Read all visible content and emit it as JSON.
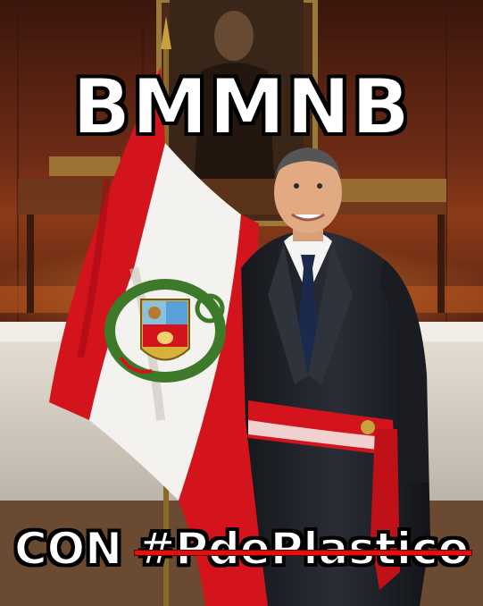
{
  "meme": {
    "top_text": "BMMNB",
    "bottom_prefix": "CON",
    "bottom_struck": "#PdePlastico",
    "strike_color": "#e01010"
  },
  "photo": {
    "subjects": [
      "man-in-suit",
      "peru-flag",
      "presidential-sash",
      "wall-portrait"
    ],
    "colors": {
      "wall": "#5a2314",
      "flag_red": "#d3141c",
      "flag_white": "#f4f2ee",
      "suit": "#1d1f25",
      "tie": "#1b2a4a"
    }
  }
}
